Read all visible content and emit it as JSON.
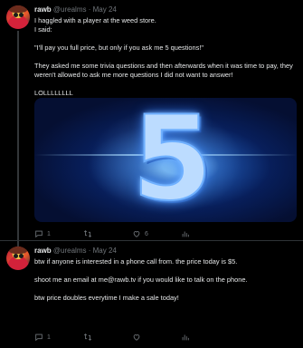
{
  "tweets": [
    {
      "display_name": "rawb",
      "handle": "@urealms",
      "separator": "·",
      "date": "May 24",
      "lines": [
        "I haggled with a player at the weed store.",
        "I said:",
        "\"I'll pay you full price, but only if you ask me 5 questions!\"",
        "They asked me some trivia questions and then afterwards when it was time to pay, they weren't allowed to ask me more questions I did not want to answer!",
        "LOLLLLLLLL"
      ],
      "media_text": "5",
      "actions": {
        "replies": "1",
        "retweets": "",
        "likes": "6",
        "views": ""
      }
    },
    {
      "display_name": "rawb",
      "handle": "@urealms",
      "separator": "·",
      "date": "May 24",
      "lines": [
        "btw if anyone is interested in a phone call from. the price today is $5.",
        "shoot me an email at me@rawb.tv if you would like to talk on the phone.",
        "btw price doubles everytime I make a sale today!"
      ],
      "actions": {
        "replies": "1",
        "retweets": "",
        "likes": "",
        "views": ""
      }
    }
  ],
  "icons": [
    "reply-icon",
    "retweet-icon",
    "like-icon",
    "views-icon"
  ],
  "colors": {
    "background": "#000000",
    "text": "#e7e9ea",
    "muted": "#71767b",
    "divider": "#2f3336"
  }
}
